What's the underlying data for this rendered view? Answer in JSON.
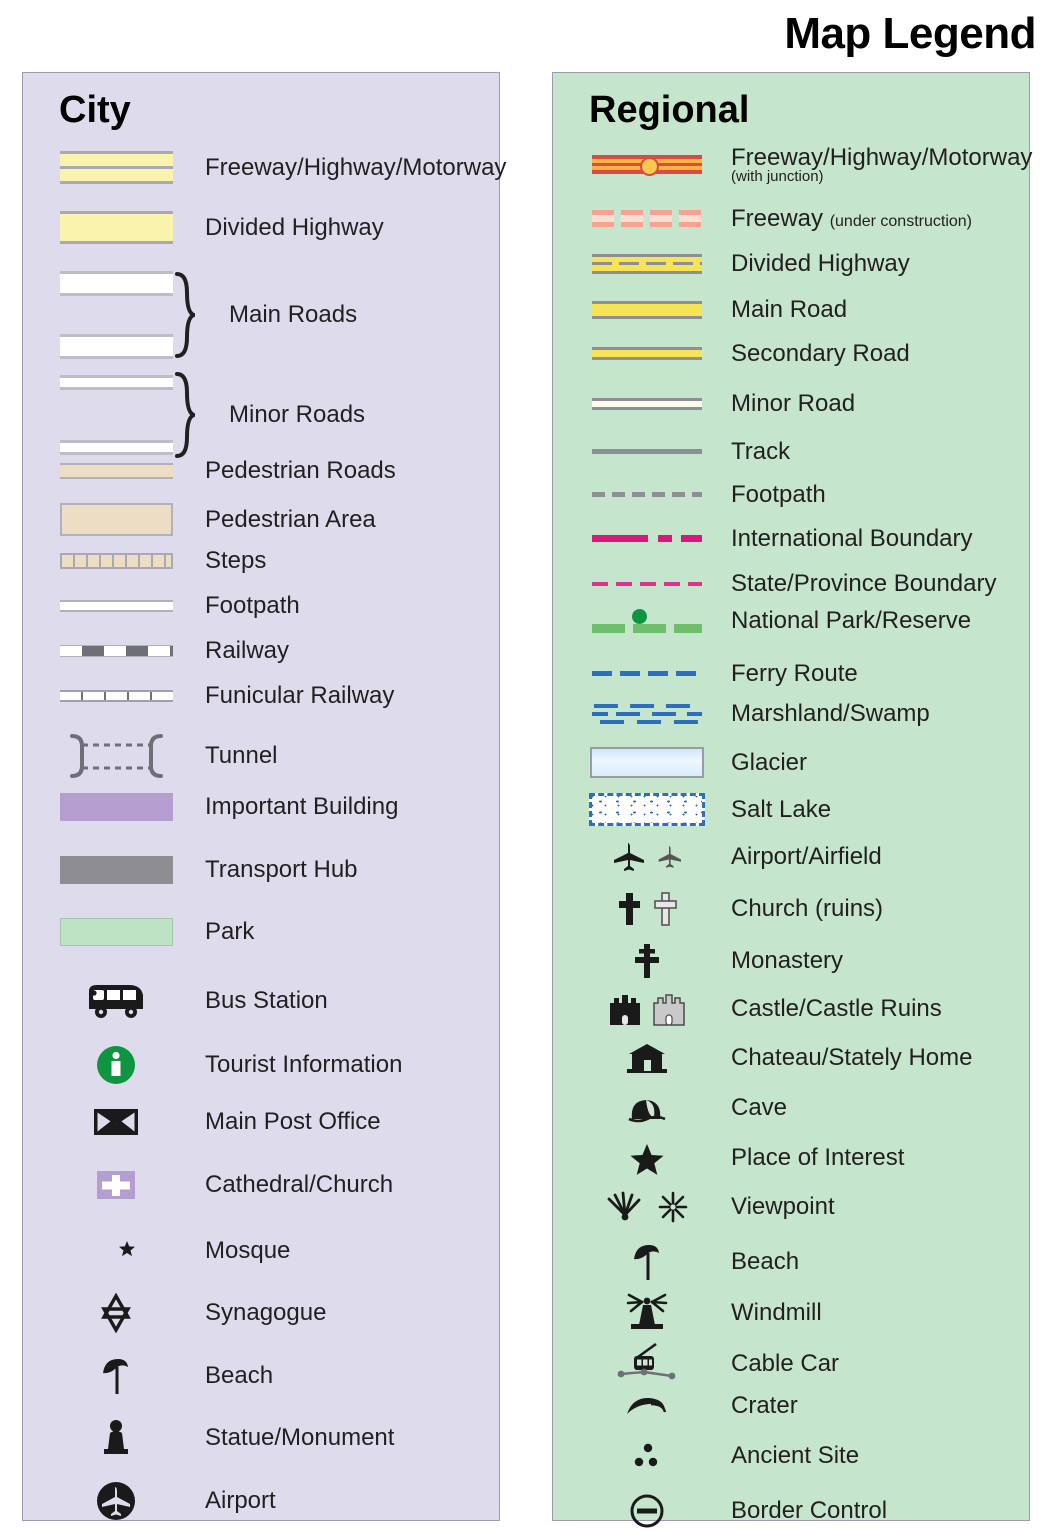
{
  "title": "Map Legend",
  "city": {
    "heading": "City",
    "bg": "#dedbed",
    "items": [
      {
        "label": "Freeway/Highway/Motorway",
        "symbol": "city-freeway"
      },
      {
        "label": "Divided Highway",
        "symbol": "city-divided"
      },
      {
        "label": "Main Roads",
        "symbol": "city-main-roads-braced"
      },
      {
        "label": "Minor Roads",
        "symbol": "city-minor-roads-braced"
      },
      {
        "label": "Pedestrian Roads",
        "symbol": "city-pedestrian-road"
      },
      {
        "label": "Pedestrian Area",
        "symbol": "city-pedestrian-area"
      },
      {
        "label": "Steps",
        "symbol": "city-steps"
      },
      {
        "label": "Footpath",
        "symbol": "city-footpath"
      },
      {
        "label": "Railway",
        "symbol": "city-railway"
      },
      {
        "label": "Funicular Railway",
        "symbol": "city-funicular-railway"
      },
      {
        "label": "Tunnel",
        "symbol": "city-tunnel"
      },
      {
        "label": "Important Building",
        "symbol": "city-important-building"
      },
      {
        "label": "Transport Hub",
        "symbol": "city-transport-hub"
      },
      {
        "label": "Park",
        "symbol": "city-park"
      },
      {
        "label": "Bus Station",
        "symbol": "bus-icon"
      },
      {
        "label": "Tourist Information",
        "symbol": "information-icon"
      },
      {
        "label": "Main Post Office",
        "symbol": "envelope-icon"
      },
      {
        "label": "Cathedral/Church",
        "symbol": "cross-on-purple-icon"
      },
      {
        "label": "Mosque",
        "symbol": "crescent-star-icon"
      },
      {
        "label": "Synagogue",
        "symbol": "star-of-david-icon"
      },
      {
        "label": "Beach",
        "symbol": "parasol-icon"
      },
      {
        "label": "Statue/Monument",
        "symbol": "statue-icon"
      },
      {
        "label": "Airport",
        "symbol": "airplane-circle-icon"
      }
    ]
  },
  "regional": {
    "heading": "Regional",
    "bg": "#c5e5cd",
    "items": [
      {
        "label": "Freeway/Highway/Motorway",
        "sublabel": "(with junction)",
        "symbol": "regional-freeway-junction"
      },
      {
        "label": "Freeway",
        "inline_sub": "(under construction)",
        "symbol": "regional-freeway-construction"
      },
      {
        "label": "Divided Highway",
        "symbol": "regional-divided-highway"
      },
      {
        "label": "Main Road",
        "symbol": "regional-main-road"
      },
      {
        "label": "Secondary Road",
        "symbol": "regional-secondary-road"
      },
      {
        "label": "Minor Road",
        "symbol": "regional-minor-road"
      },
      {
        "label": "Track",
        "symbol": "regional-track"
      },
      {
        "label": "Footpath",
        "symbol": "regional-footpath"
      },
      {
        "label": "International Boundary",
        "symbol": "regional-international-boundary"
      },
      {
        "label": "State/Province Boundary",
        "symbol": "regional-state-boundary"
      },
      {
        "label": "National Park/Reserve",
        "symbol": "regional-national-park"
      },
      {
        "label": "Ferry Route",
        "symbol": "regional-ferry-route"
      },
      {
        "label": "Marshland/Swamp",
        "symbol": "regional-marshland"
      },
      {
        "label": "Glacier",
        "symbol": "regional-glacier"
      },
      {
        "label": "Salt Lake",
        "symbol": "regional-salt-lake"
      },
      {
        "label": "Airport/Airfield",
        "symbol": "airplane-pair-icon"
      },
      {
        "label": "Church (ruins)",
        "symbol": "cross-pair-icon"
      },
      {
        "label": "Monastery",
        "symbol": "orthodox-cross-icon"
      },
      {
        "label": "Castle/Castle Ruins",
        "symbol": "castle-pair-icon"
      },
      {
        "label": "Chateau/Stately Home",
        "symbol": "chateau-icon"
      },
      {
        "label": "Cave",
        "symbol": "cave-icon"
      },
      {
        "label": "Place of Interest",
        "symbol": "star-icon"
      },
      {
        "label": "Viewpoint",
        "symbol": "viewpoint-pair-icon"
      },
      {
        "label": "Beach",
        "symbol": "parasol-icon"
      },
      {
        "label": "Windmill",
        "symbol": "windmill-icon"
      },
      {
        "label": "Cable Car",
        "symbol": "cable-car-icon"
      },
      {
        "label": "Crater",
        "symbol": "crater-icon"
      },
      {
        "label": "Ancient Site",
        "symbol": "ancient-site-icon"
      },
      {
        "label": "Border Control",
        "symbol": "border-control-icon"
      }
    ]
  },
  "colors": {
    "city_panel": "#dedbed",
    "regional_panel": "#c5e5cd",
    "highway_yellow": "#faf3ae",
    "road_yellow": "#f7e455",
    "pedestrian_beige": "#ecddc4",
    "important_building": "#b49ed0",
    "transport_hub": "#8d8d92",
    "park_green": "#bde2c4",
    "tourist_green": "#0f9540",
    "freeway_red": "#d94b43",
    "freeway_orange": "#f5b73f",
    "boundary_magenta": "#d6197f",
    "ferry_blue": "#2d6fba",
    "natpark_green": "#6ebf6b",
    "text": "#231f20"
  }
}
